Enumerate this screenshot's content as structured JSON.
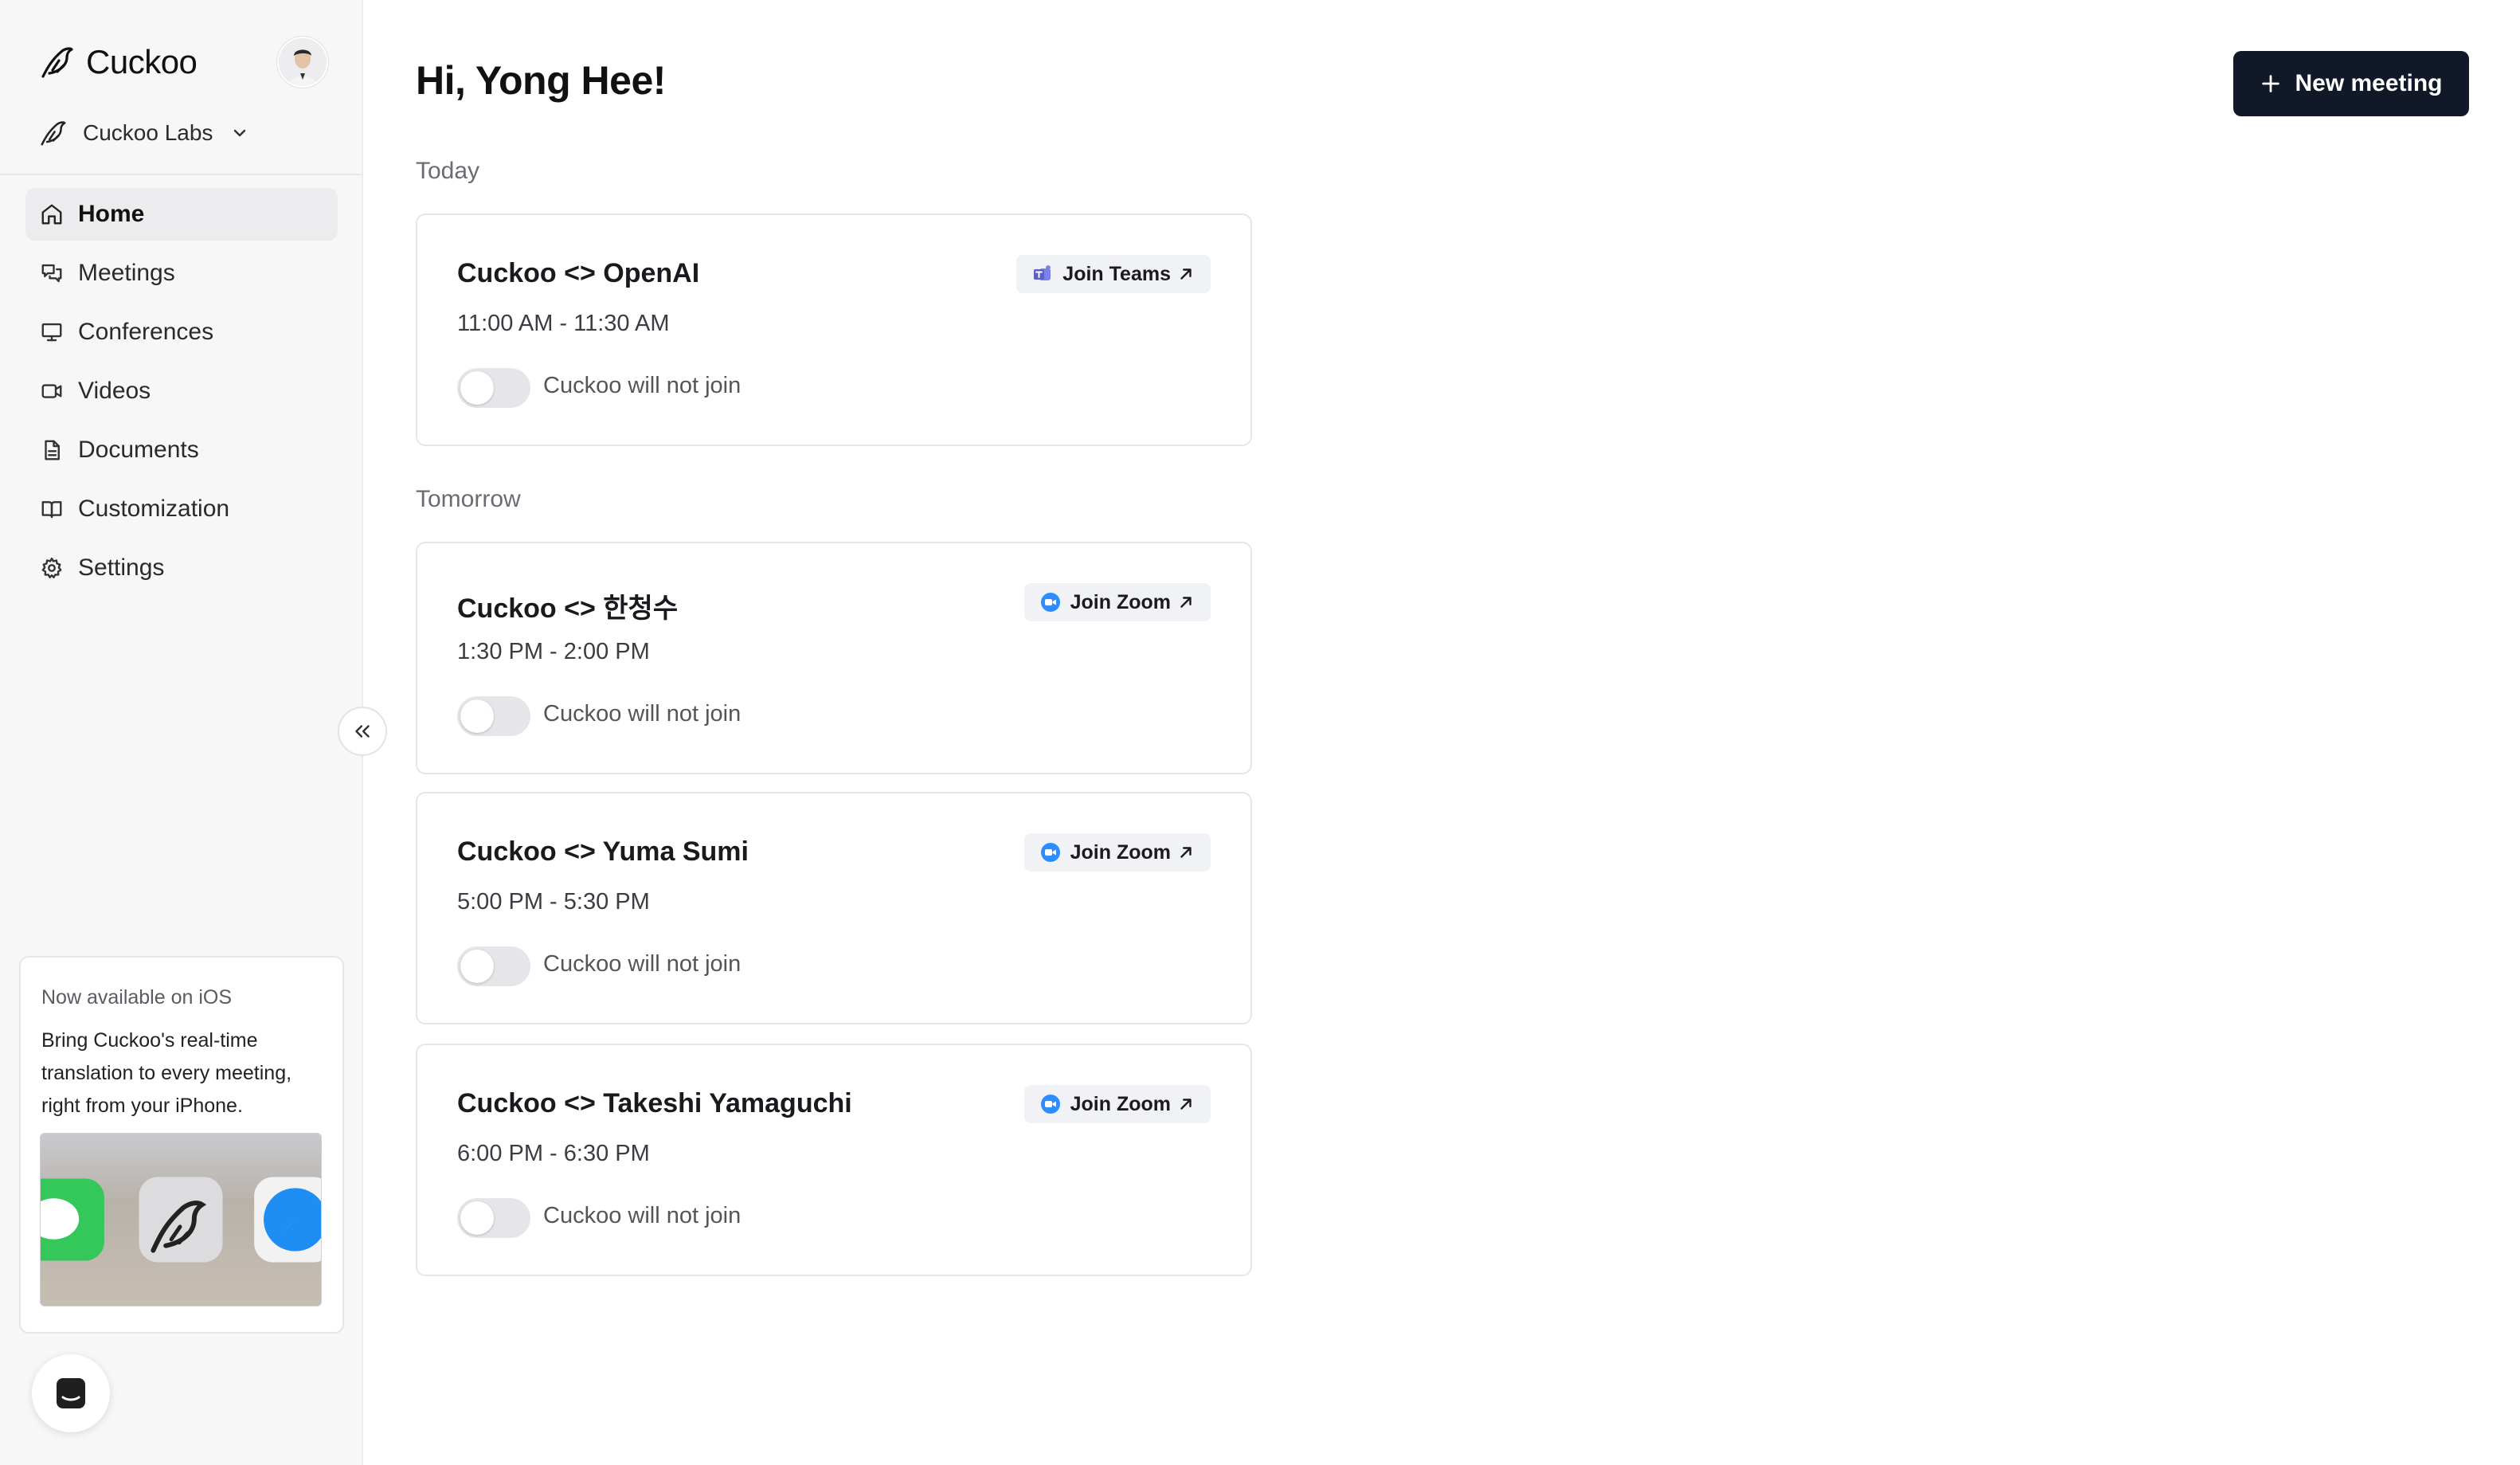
{
  "app": {
    "name": "Cuckoo"
  },
  "org": {
    "name": "Cuckoo Labs"
  },
  "nav": [
    {
      "label": "Home",
      "icon": "home-icon",
      "active": true
    },
    {
      "label": "Meetings",
      "icon": "meetings-icon"
    },
    {
      "label": "Conferences",
      "icon": "conferences-icon"
    },
    {
      "label": "Videos",
      "icon": "video-icon"
    },
    {
      "label": "Documents",
      "icon": "document-icon"
    },
    {
      "label": "Customization",
      "icon": "book-icon"
    },
    {
      "label": "Settings",
      "icon": "gear-icon"
    }
  ],
  "promo": {
    "eyebrow": "Now available on iOS",
    "text": "Bring Cuckoo's real-time translation to every meeting, right from your iPhone."
  },
  "main": {
    "greeting": "Hi, Yong Hee!",
    "new_meeting_label": "New meeting",
    "sections": [
      {
        "label": "Today"
      },
      {
        "label": "Tomorrow"
      }
    ],
    "meetings": [
      {
        "title": "Cuckoo <> OpenAI",
        "time": "11:00 AM - 11:30 AM",
        "join_label": "Join Teams",
        "service": "teams-icon",
        "status": "Cuckoo will not join"
      },
      {
        "title": "Cuckoo <> 한청수",
        "time": "1:30 PM - 2:00 PM",
        "join_label": "Join Zoom",
        "service": "zoom-icon",
        "status": "Cuckoo will not join"
      },
      {
        "title": "Cuckoo <> Yuma Sumi",
        "time": "5:00 PM - 5:30 PM",
        "join_label": "Join Zoom",
        "service": "zoom-icon",
        "status": "Cuckoo will not join"
      },
      {
        "title": "Cuckoo <> Takeshi Yamaguchi",
        "time": "6:00 PM - 6:30 PM",
        "join_label": "Join Zoom",
        "service": "zoom-icon",
        "status": "Cuckoo will not join"
      }
    ]
  },
  "colors": {
    "primary_button": "#111827",
    "zoom": "#2D8CFF",
    "teams": "#5B5FC7"
  }
}
